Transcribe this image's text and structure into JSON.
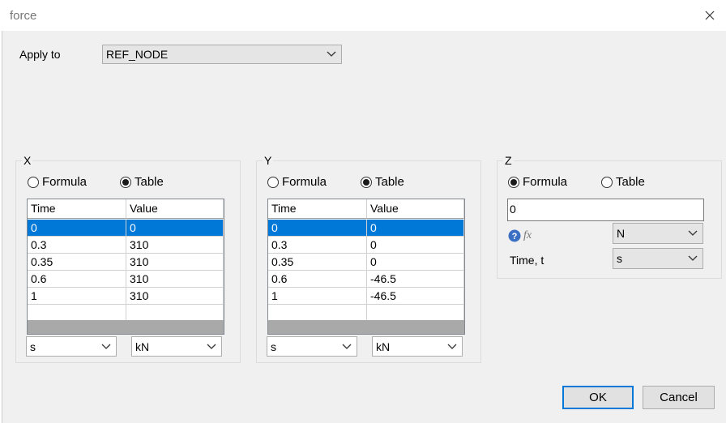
{
  "window": {
    "title": "force"
  },
  "apply_to": {
    "label": "Apply to",
    "value": "REF_NODE"
  },
  "group_x": {
    "title": "X",
    "radio_formula": "Formula",
    "radio_table": "Table",
    "selected": "Table",
    "columns": [
      "Time",
      "Value"
    ],
    "rows": [
      [
        "0",
        "0"
      ],
      [
        "0.3",
        "310"
      ],
      [
        "0.35",
        "310"
      ],
      [
        "0.6",
        "310"
      ],
      [
        "1",
        "310"
      ],
      [
        "",
        ""
      ]
    ],
    "time_unit": "s",
    "value_unit": "kN"
  },
  "group_y": {
    "title": "Y",
    "radio_formula": "Formula",
    "radio_table": "Table",
    "selected": "Table",
    "columns": [
      "Time",
      "Value"
    ],
    "rows": [
      [
        "0",
        "0"
      ],
      [
        "0.3",
        "0"
      ],
      [
        "0.35",
        "0"
      ],
      [
        "0.6",
        "-46.5"
      ],
      [
        "1",
        "-46.5"
      ],
      [
        "",
        ""
      ]
    ],
    "time_unit": "s",
    "value_unit": "kN"
  },
  "group_z": {
    "title": "Z",
    "radio_formula": "Formula",
    "radio_table": "Table",
    "selected": "Formula",
    "formula_value": "0",
    "fx_label": "fx",
    "unit": "N",
    "time_label": "Time, t",
    "time_unit": "s"
  },
  "buttons": {
    "ok": "OK",
    "cancel": "Cancel"
  },
  "colors": {
    "selection": "#0078d7",
    "default_button_border": "#0078d7",
    "help_icon": "#3b6fc4"
  }
}
